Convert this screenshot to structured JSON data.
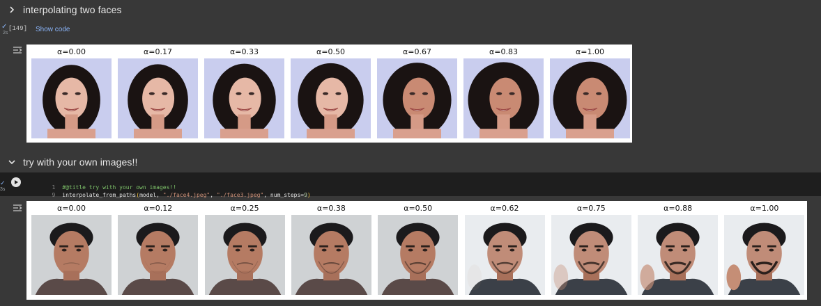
{
  "section1": {
    "title": "interpolating two faces",
    "exec_status": "✓",
    "exec_time": "2s",
    "exec_count": "[149]",
    "show_code": "Show code",
    "labels": [
      "α=0.00",
      "α=0.17",
      "α=0.33",
      "α=0.50",
      "α=0.67",
      "α=0.83",
      "α=1.00"
    ],
    "image_kind": "interpolated woman face"
  },
  "section2": {
    "title": "try with your own images!!",
    "exec_time": "3s",
    "code_lines": [
      {
        "num": "1",
        "comment": "#@title try with your own images!!"
      },
      {
        "num": "9",
        "fn": "interpolate_from_paths",
        "open": "(",
        "arg1": "model, ",
        "str1": "\"./face4.jpeg\"",
        "sep": ", ",
        "str2": "\"./face3.jpeg\"",
        "arg3": ", num_steps=",
        "close": ")"
      }
    ],
    "labels": [
      "α=0.00",
      "α=0.12",
      "α=0.25",
      "α=0.38",
      "α=0.50",
      "α=0.62",
      "α=0.75",
      "α=0.88",
      "α=1.00"
    ],
    "image_kind": "interpolated man face"
  },
  "icons": {
    "chevron_right": "chevron-right-icon",
    "chevron_down": "chevron-down-icon",
    "run": "play-icon",
    "output_toggle": "output-toggle-icon"
  },
  "colors": {
    "background": "#383838",
    "code_background": "#1e1e1e",
    "link": "#8ab4f8"
  }
}
